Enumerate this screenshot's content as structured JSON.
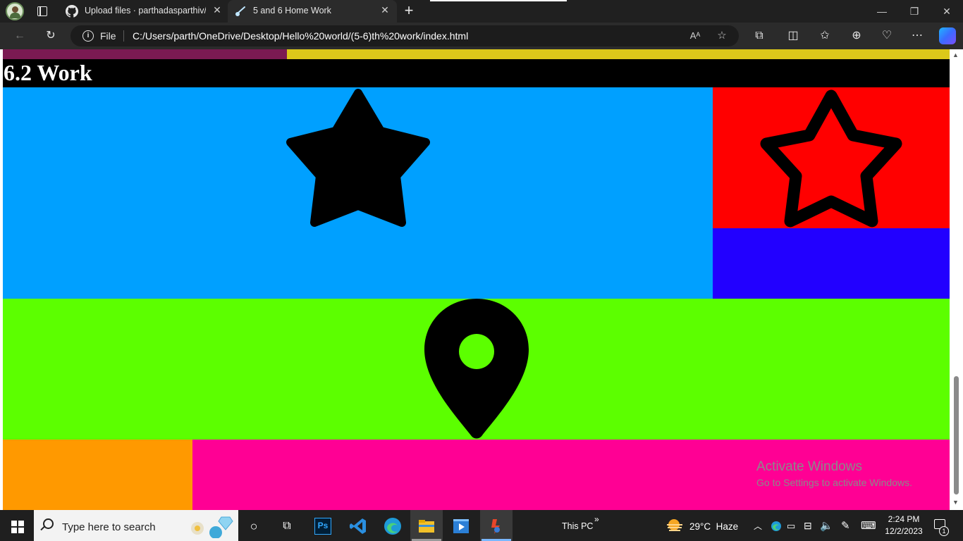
{
  "browser": {
    "tabs": [
      {
        "title": "Upload files · parthadasparthiv/5",
        "active": false
      },
      {
        "title": "5 and 6 Home Work",
        "active": true
      }
    ],
    "address": {
      "scheme_label": "File",
      "url": "C:/Users/parth/OneDrive/Desktop/Hello%20world/(5-6)th%20work/index.html"
    }
  },
  "page": {
    "heading": "6.2 Work",
    "colors": {
      "strip_left": "#7b1a52",
      "strip_right": "#dcc81a",
      "heading_bg": "#000000",
      "blue": "#00a0ff",
      "red": "#ff0000",
      "indigo": "#2200ff",
      "green": "#5cff00",
      "orange": "#ff9900",
      "magenta": "#ff0094"
    },
    "icons": [
      "star-solid-icon",
      "star-outline-icon",
      "location-pin-icon"
    ]
  },
  "watermark": {
    "title": "Activate Windows",
    "subtitle": "Go to Settings to activate Windows."
  },
  "taskbar": {
    "search_placeholder": "Type here to search",
    "this_pc": "This PC",
    "chevron": "»",
    "weather": "29°C  Haze",
    "time": "2:24 PM",
    "date": "12/2/2023",
    "notification_count": "1"
  }
}
